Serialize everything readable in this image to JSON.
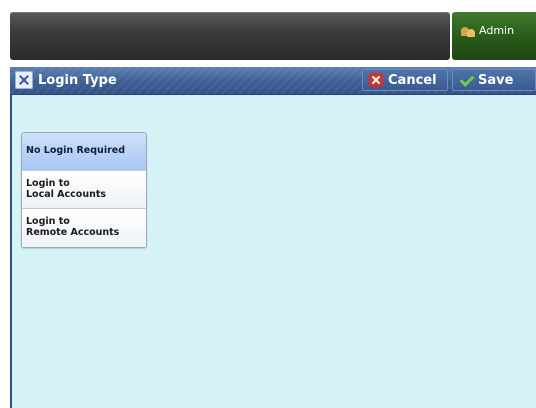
{
  "header": {
    "admin_label": "Admin"
  },
  "titlebar": {
    "title": "Login Type",
    "cancel_label": "Cancel",
    "save_label": "Save"
  },
  "options": [
    {
      "label": "No Login Required",
      "selected": true
    },
    {
      "label": "Login to\nLocal Accounts",
      "selected": false
    },
    {
      "label": "Login to\nRemote Accounts",
      "selected": false
    }
  ],
  "icons": {
    "admin": "admin-users-icon",
    "title": "tools-icon",
    "cancel": "red-x-icon",
    "save": "green-check-icon"
  },
  "colors": {
    "content_bg": "#d5f2f6",
    "title_bar": "#3d5f94",
    "admin_button": "#285a1a",
    "selected_option": "#a9c6f3"
  }
}
